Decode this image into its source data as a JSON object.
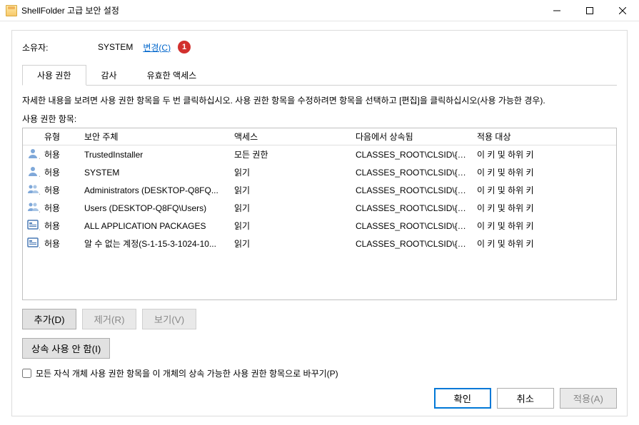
{
  "window": {
    "title": "ShellFolder 고급 보안 설정"
  },
  "owner": {
    "label": "소유자:",
    "name": "SYSTEM",
    "change_link": "변경(C)",
    "badge": "1"
  },
  "tabs": {
    "permissions": "사용 권한",
    "auditing": "감사",
    "effective": "유효한 액세스"
  },
  "description": "자세한 내용을 보려면 사용 권한 항목을 두 번 클릭하십시오. 사용 권한 항목을 수정하려면 항목을 선택하고 [편집]을 클릭하십시오(사용 가능한 경우).",
  "entries_label": "사용 권한 항목:",
  "columns": {
    "type": "유형",
    "principal": "보안 주체",
    "access": "액세스",
    "inherited": "다음에서 상속됨",
    "applies": "적용 대상"
  },
  "rows": [
    {
      "icon": "user",
      "type": "허용",
      "principal": "TrustedInstaller",
      "access": "모든 권한",
      "inherited": "CLASSES_ROOT\\CLSID\\{F...",
      "applies": "이 키 및 하위 키"
    },
    {
      "icon": "user",
      "type": "허용",
      "principal": "SYSTEM",
      "access": "읽기",
      "inherited": "CLASSES_ROOT\\CLSID\\{F...",
      "applies": "이 키 및 하위 키"
    },
    {
      "icon": "group",
      "type": "허용",
      "principal": "Administrators (DESKTOP-Q8FQ...",
      "access": "읽기",
      "inherited": "CLASSES_ROOT\\CLSID\\{F...",
      "applies": "이 키 및 하위 키"
    },
    {
      "icon": "group",
      "type": "허용",
      "principal": "Users (DESKTOP-Q8FQ\\Users)",
      "access": "읽기",
      "inherited": "CLASSES_ROOT\\CLSID\\{F...",
      "applies": "이 키 및 하위 키"
    },
    {
      "icon": "app",
      "type": "허용",
      "principal": "ALL APPLICATION PACKAGES",
      "access": "읽기",
      "inherited": "CLASSES_ROOT\\CLSID\\{F...",
      "applies": "이 키 및 하위 키"
    },
    {
      "icon": "app",
      "type": "허용",
      "principal": "알 수 없는 계정(S-1-15-3-1024-10...",
      "access": "읽기",
      "inherited": "CLASSES_ROOT\\CLSID\\{F...",
      "applies": "이 키 및 하위 키"
    }
  ],
  "buttons": {
    "add": "추가(D)",
    "remove": "제거(R)",
    "view": "보기(V)",
    "disable_inherit": "상속 사용 안 함(I)",
    "replace_children": "모든 자식 개체 사용 권한 항목을 이 개체의 상속 가능한 사용 권한 항목으로 바꾸기(P)",
    "ok": "확인",
    "cancel": "취소",
    "apply": "적용(A)"
  }
}
